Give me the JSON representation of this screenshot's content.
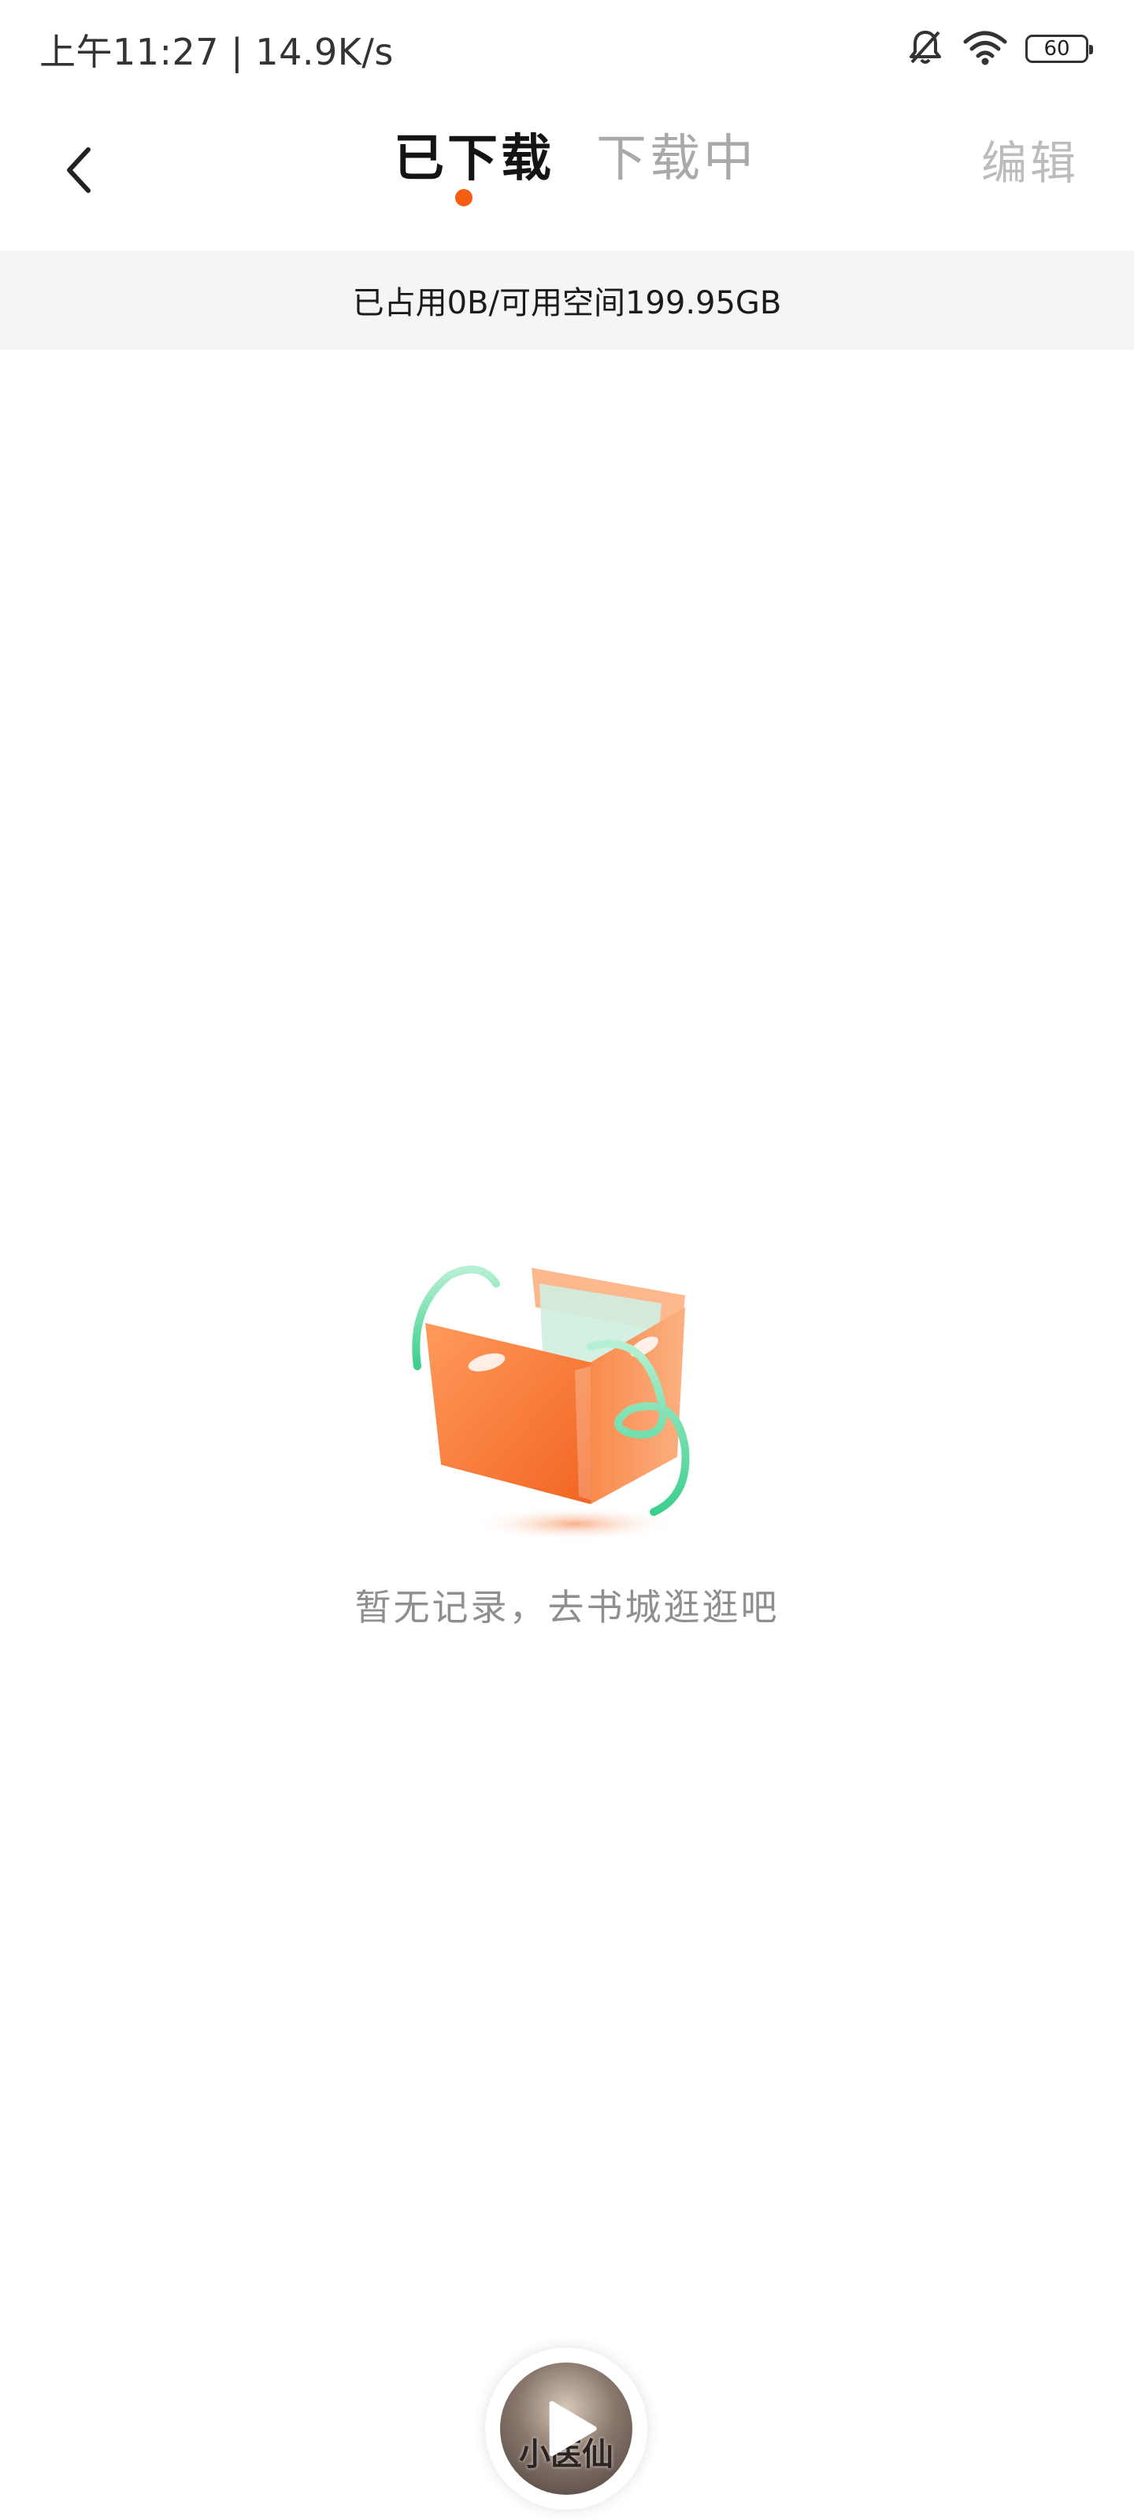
{
  "status_bar": {
    "time_speed": "上午11:27 | 14.9K/s",
    "battery_level": "60",
    "icons": [
      "mute-bell-icon",
      "wifi-icon",
      "battery-icon"
    ]
  },
  "header": {
    "tabs": [
      {
        "label": "已下载",
        "active": true
      },
      {
        "label": "下载中",
        "active": false
      }
    ],
    "edit_label": "编辑",
    "accent_color": "#f55d12"
  },
  "storage": {
    "text": "已占用0B/可用空间199.95GB"
  },
  "empty_state": {
    "message": "暂无记录，去书城逛逛吧",
    "icon": "empty-basket-illustration"
  },
  "player": {
    "cover_title": "小医仙",
    "icon": "play-icon"
  }
}
